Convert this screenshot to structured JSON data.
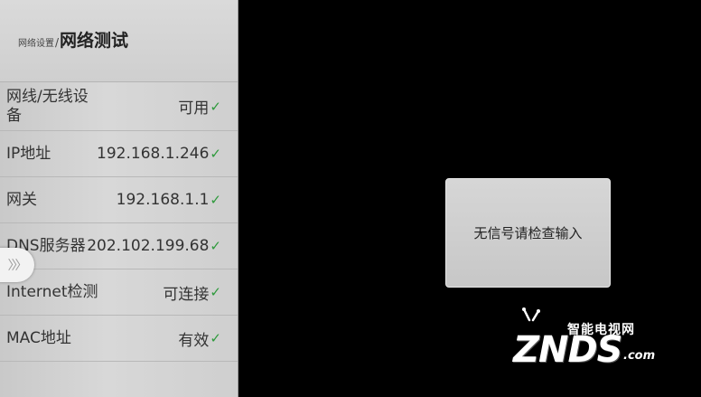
{
  "panel": {
    "breadcrumb_parent": "网络设置",
    "breadcrumb_separator": "/",
    "title": "网络测试",
    "rows": [
      {
        "label": "网线/无线设备",
        "value": "可用"
      },
      {
        "label": "IP地址",
        "value": "192.168.1.246"
      },
      {
        "label": "网关",
        "value": "192.168.1.1"
      },
      {
        "label": "DNS服务器",
        "value": "202.102.199.68"
      },
      {
        "label": "Internet检测",
        "value": "可连接"
      },
      {
        "label": "MAC地址",
        "value": "有效"
      }
    ],
    "check_glyph": "✓",
    "check_color": "#2e9a3c"
  },
  "expander": {
    "icon": "chevrons-right-icon",
    "glyph": "〉〉〉"
  },
  "dialog": {
    "message": "无信号请检查输入"
  },
  "watermark": {
    "tagline": "智能电视网",
    "brand": "ZNDS",
    "suffix": ".com"
  }
}
